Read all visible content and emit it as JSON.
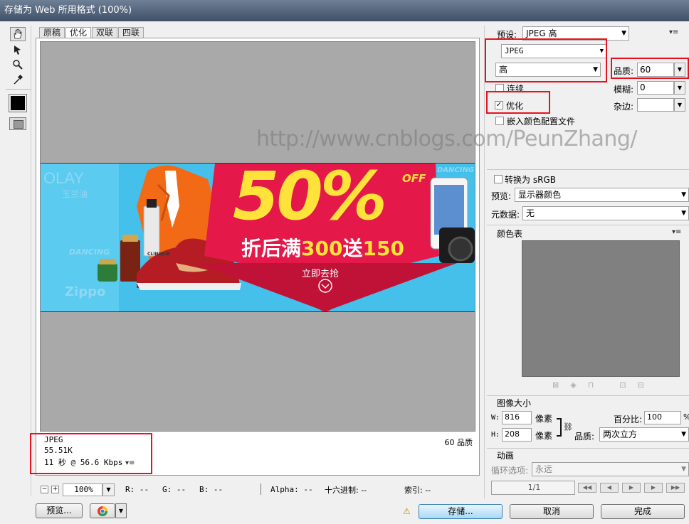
{
  "window": {
    "title": "存储为 Web 所用格式 (100%)"
  },
  "tools": {
    "hand": "hand-tool",
    "slice": "slice-select-tool",
    "zoom": "zoom-tool",
    "eyedropper": "eyedropper-tool"
  },
  "tabs": [
    "原稿",
    "优化",
    "双联",
    "四联"
  ],
  "banner": {
    "big": "50%",
    "off": "OFF",
    "promo_a": "折后满",
    "promo_b": "300",
    "promo_c": "送",
    "promo_d": "150",
    "cta": "立即去抢",
    "brand_olay": "OLAY",
    "brand_olay_cn": "玉兰油",
    "brand_dancing": "DANCING",
    "brand_zippo": "Zippo",
    "brand_clinique": "CLINIQUE",
    "brand_dancing2": "DANCING"
  },
  "info": {
    "format": "JPEG",
    "size": "55.51K",
    "time": "11 秒 @ 56.6 Kbps",
    "quality": "60 品质"
  },
  "status": {
    "zoom": "100%",
    "r": "R: --",
    "g": "G: --",
    "b": "B: --",
    "alpha": "Alpha: --",
    "hex": "十六进制: --",
    "index": "索引: --"
  },
  "bottom": {
    "preview": "预览...",
    "save": "存储...",
    "cancel": "取消",
    "done": "完成"
  },
  "settings": {
    "preset_label": "预设:",
    "preset_value": "JPEG 高",
    "format_value": "JPEG",
    "quality_level": "高",
    "quality_label": "品质:",
    "quality_value": "60",
    "progressive": "连续",
    "blur_label": "模糊:",
    "blur_value": "0",
    "optimized": "优化",
    "matte_label": "杂边:",
    "embed_profile": "嵌入颜色配置文件",
    "convert_srgb": "转换为 sRGB",
    "preview_label": "预览:",
    "preview_value": "显示器颜色",
    "metadata_label": "元数据:",
    "metadata_value": "无",
    "color_table": "颜色表"
  },
  "image_size": {
    "title": "图像大小",
    "w_label": "W:",
    "w_value": "816",
    "w_unit": "像素",
    "h_label": "H:",
    "h_value": "208",
    "h_unit": "像素",
    "percent_label": "百分比:",
    "percent_value": "100",
    "percent_unit": "%",
    "quality_label": "品质:",
    "quality_value": "两次立方"
  },
  "animation": {
    "title": "动画",
    "loop_label": "循环选项:",
    "loop_value": "永远",
    "frame": "1/1"
  },
  "watermark": "http://www.cnblogs.com/PeunZhang/",
  "colors": {
    "red": "#e8121e",
    "banner_blue": "#45c0ea",
    "banner_pink": "#e4194a",
    "yellow": "#ffe23a"
  }
}
